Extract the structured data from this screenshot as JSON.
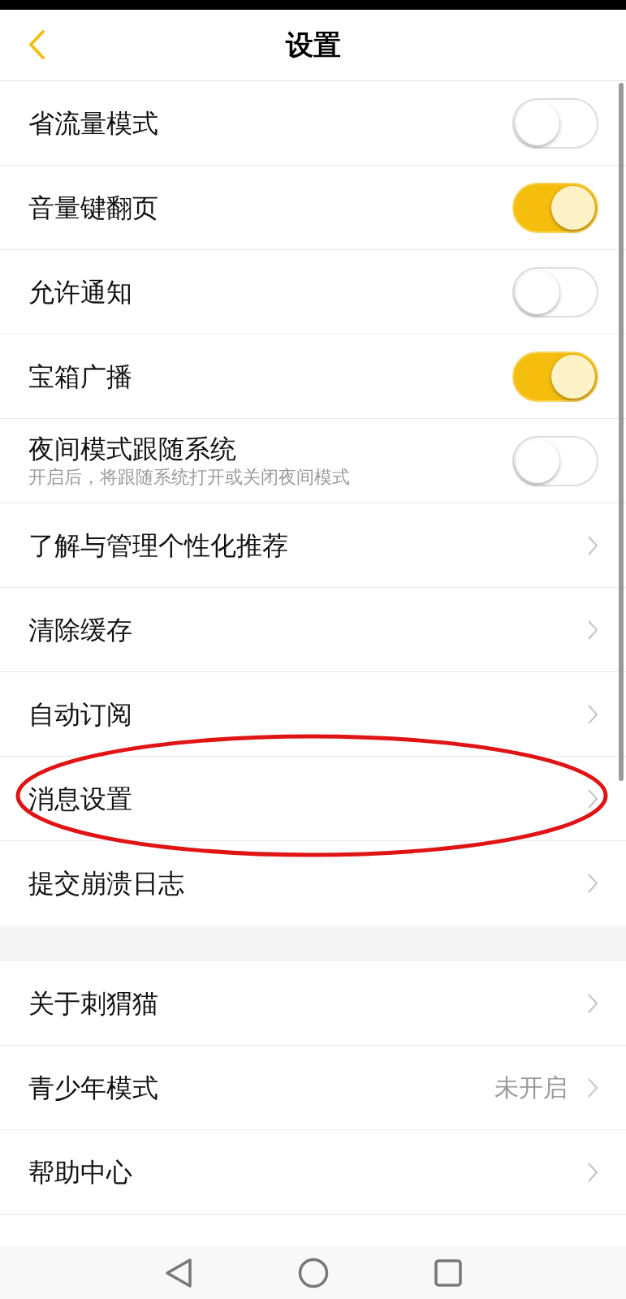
{
  "header": {
    "title": "设置"
  },
  "sections": [
    {
      "rows": [
        {
          "kind": "toggle",
          "label": "省流量模式",
          "on": false
        },
        {
          "kind": "toggle",
          "label": "音量键翻页",
          "on": true
        },
        {
          "kind": "toggle",
          "label": "允许通知",
          "on": false
        },
        {
          "kind": "toggle",
          "label": "宝箱广播",
          "on": true
        },
        {
          "kind": "toggle",
          "label": "夜间模式跟随系统",
          "subtitle": "开启后，将跟随系统打开或关闭夜间模式",
          "on": false
        },
        {
          "kind": "link",
          "label": "了解与管理个性化推荐"
        },
        {
          "kind": "link",
          "label": "清除缓存"
        },
        {
          "kind": "link",
          "label": "自动订阅"
        },
        {
          "kind": "link",
          "label": "消息设置",
          "circled": true
        },
        {
          "kind": "link",
          "label": "提交崩溃日志"
        }
      ]
    },
    {
      "rows": [
        {
          "kind": "link",
          "label": "关于刺猬猫"
        },
        {
          "kind": "link",
          "label": "青少年模式",
          "value": "未开启"
        },
        {
          "kind": "link",
          "label": "帮助中心"
        }
      ]
    }
  ]
}
